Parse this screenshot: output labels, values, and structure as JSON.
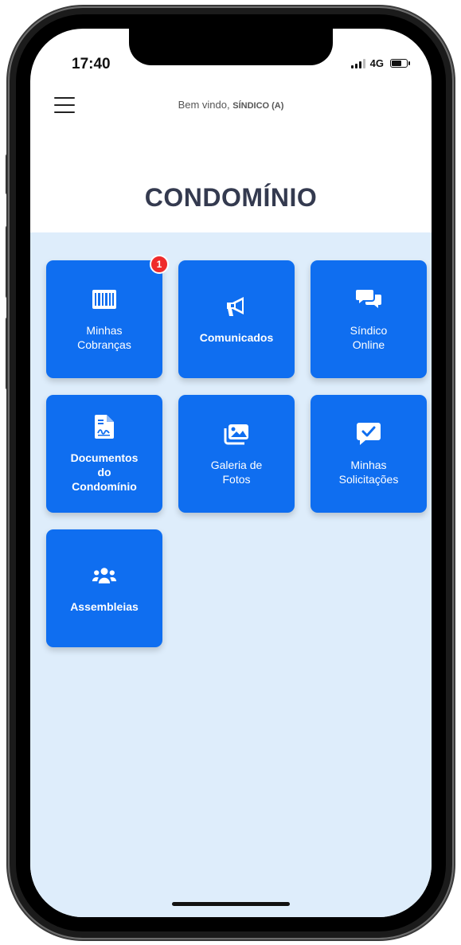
{
  "status_bar": {
    "time": "17:40",
    "network": "4G",
    "battery_level": 0.6
  },
  "header": {
    "welcome_text": "Bem vindo,",
    "user_name": "SÍNDICO (A)",
    "menu_icon": "hamburger-menu-icon"
  },
  "page": {
    "title": "CONDOMÍNIO"
  },
  "colors": {
    "tile_background": "#0f6ef0",
    "content_background": "#deedfb",
    "badge": "#ef2b2b",
    "title": "#343a4f"
  },
  "tiles": [
    {
      "label": "Minhas\nCobranças",
      "icon": "barcode-icon",
      "badge": "1"
    },
    {
      "label": "Comunicados",
      "icon": "megaphone-icon"
    },
    {
      "label": "Síndico\nOnline",
      "icon": "chat-bubbles-icon"
    },
    {
      "label": "Documentos\ndo\nCondomínio",
      "icon": "document-icon"
    },
    {
      "label": "Galeria de\nFotos",
      "icon": "photo-gallery-icon"
    },
    {
      "label": "Minhas\nSolicitações",
      "icon": "checked-message-icon"
    },
    {
      "label": "Assembleias",
      "icon": "users-group-icon"
    }
  ]
}
